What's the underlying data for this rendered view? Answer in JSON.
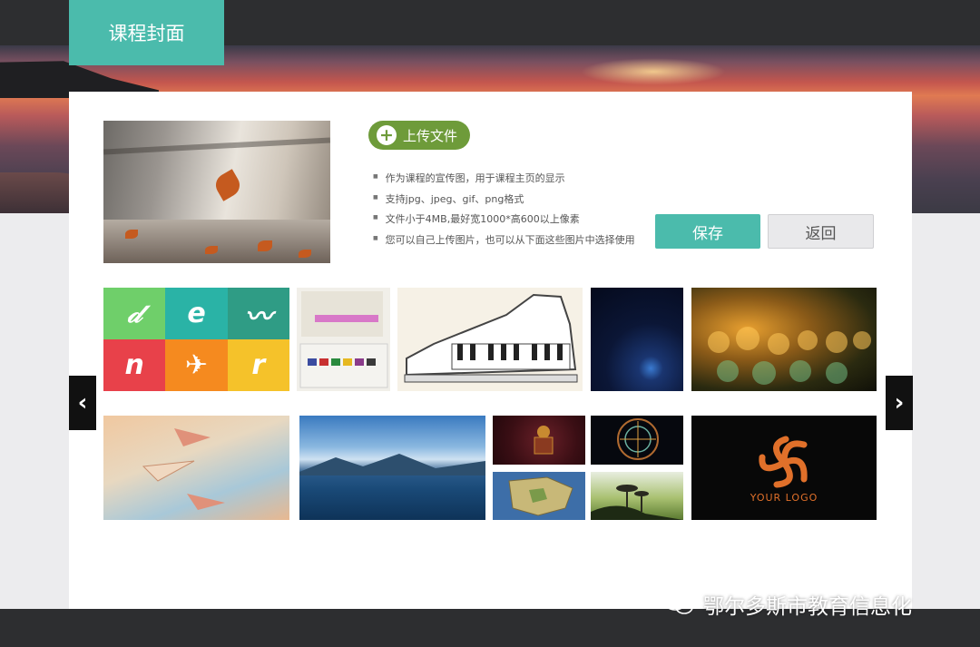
{
  "header": {
    "tab_title": "课程封面"
  },
  "upload": {
    "button_label": "上传文件"
  },
  "tips": [
    "作为课程的宣传图，用于课程主页的显示",
    "支持jpg、jpeg、gif、png格式",
    "文件小于4MB,最好宽1000*高600以上像素",
    "您可以自己上传图片，也可以从下面这些图片中选择使用"
  ],
  "actions": {
    "save_label": "保存",
    "back_label": "返回"
  },
  "gallery": {
    "logo_text": "YOUR LOGO"
  },
  "watermark": {
    "text": "鄂尔多斯市教育信息化"
  },
  "colors": {
    "accent": "#4bbbac",
    "upload_green": "#6e9b3a",
    "dark_bar": "#2d2e30"
  }
}
